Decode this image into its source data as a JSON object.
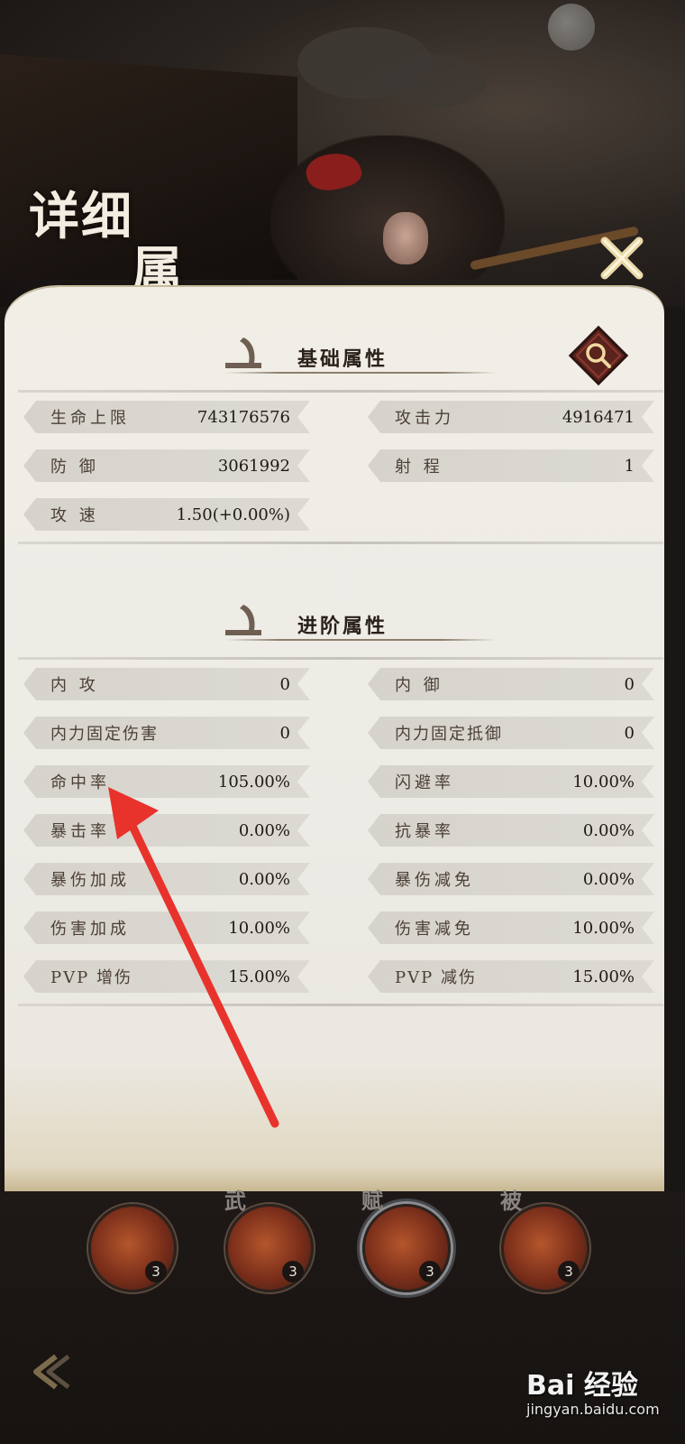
{
  "header": {
    "title_line1": "详细",
    "title_line2": "属性"
  },
  "basic_section": {
    "title": "基础属性",
    "stats": [
      {
        "label": "生命上限",
        "value": "743176576"
      },
      {
        "label": "攻击力",
        "value": "4916471"
      },
      {
        "label": "防  御",
        "value": "3061992"
      },
      {
        "label": "射  程",
        "value": "1"
      },
      {
        "label": "攻  速",
        "value": "1.50(+0.00%)"
      }
    ]
  },
  "advanced_section": {
    "title": "进阶属性",
    "stats": [
      {
        "label": "内  攻",
        "value": "0"
      },
      {
        "label": "内  御",
        "value": "0"
      },
      {
        "label": "内力固定伤害",
        "value": "0"
      },
      {
        "label": "内力固定抵御",
        "value": "0"
      },
      {
        "label": "命中率",
        "value": "105.00%"
      },
      {
        "label": "闪避率",
        "value": "10.00%"
      },
      {
        "label": "暴击率",
        "value": "0.00%"
      },
      {
        "label": "抗暴率",
        "value": "0.00%"
      },
      {
        "label": "暴伤加成",
        "value": "0.00%"
      },
      {
        "label": "暴伤减免",
        "value": "0.00%"
      },
      {
        "label": "伤害加成",
        "value": "10.00%"
      },
      {
        "label": "伤害减免",
        "value": "10.00%"
      },
      {
        "label": "PVP 增伤",
        "value": "15.00%"
      },
      {
        "label": "PVP 减伤",
        "value": "15.00%"
      }
    ]
  },
  "skills": [
    {
      "tag": "",
      "count": "3"
    },
    {
      "tag": "武",
      "count": "3"
    },
    {
      "tag": "赋",
      "count": "3"
    },
    {
      "tag": "被",
      "count": "3"
    }
  ],
  "watermark": {
    "main": "Bai 经验",
    "sub": "jingyan.baidu.com"
  },
  "colors": {
    "panel_bg": "#eeebe4",
    "stat_bar": "#d8d5ce",
    "arrow": "#e8332c",
    "search_btn_bg": "#5a231d"
  },
  "icons": [
    "close-icon",
    "search-icon",
    "back-arrow-icon",
    "ink-brush-icon"
  ]
}
